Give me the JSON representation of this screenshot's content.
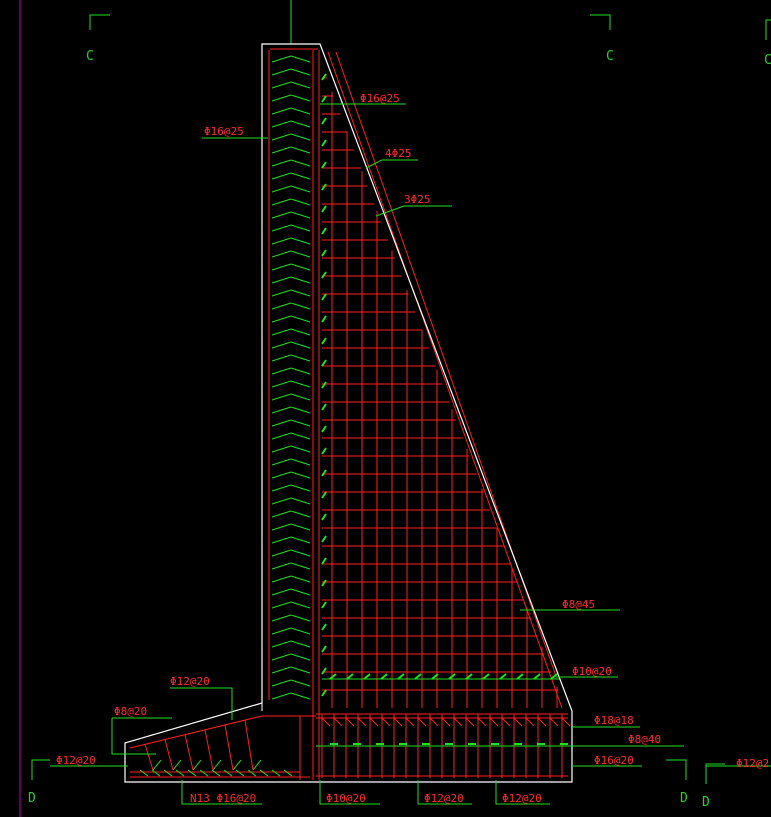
{
  "colors": {
    "background": "#000000",
    "outline": "#ffffff",
    "rebar": "#ff2020",
    "leader": "#20e020",
    "edge_line": "#c000c0"
  },
  "section_marks": {
    "c_left": "C",
    "c_right": "C",
    "c_far_right": "C",
    "d_left": "D",
    "d_right": "D",
    "d_far_right": "D"
  },
  "labels": {
    "stem_top_inner": "Φ16@25",
    "stem_left": "Φ16@25",
    "slope_upper": "4Φ25",
    "slope_lower": "3Φ25",
    "horizontal_mid": "Φ8@45",
    "horizontal_low": "Φ10@20",
    "toe_top": "Φ12@20",
    "toe_mid": "Φ8@20",
    "toe_end": "Φ12@20",
    "heel_top": "Φ18@18",
    "heel_mid": "Φ8@40",
    "heel_bottom": "Φ16@20",
    "far_right": "Φ12@2",
    "bottom_n13": "N13 Φ16@20",
    "bottom_1": "Φ10@20",
    "bottom_2": "Φ12@20",
    "bottom_3": "Φ12@20"
  }
}
